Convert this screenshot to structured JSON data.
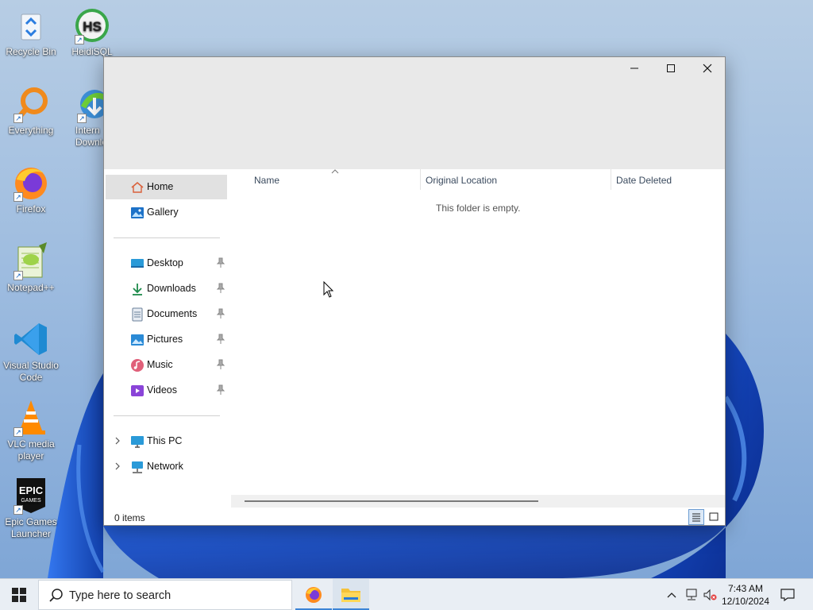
{
  "desktop": {
    "icons": [
      {
        "label": "Recycle Bin"
      },
      {
        "label": "HeidiSQL"
      },
      {
        "label": "Everything"
      },
      {
        "label": "Intern Downlo"
      },
      {
        "label": "Firefox"
      },
      {
        "label": "Notepad++"
      },
      {
        "label": "Visual Studio Code"
      },
      {
        "label": "VLC media player"
      },
      {
        "label": "Epic Games Launcher"
      }
    ]
  },
  "window": {
    "controls": {
      "minimize": "—",
      "maximize": "☐",
      "close": "✕"
    },
    "nav": {
      "items": [
        {
          "label": "Home",
          "icon": "home-icon",
          "selected": true
        },
        {
          "label": "Gallery",
          "icon": "gallery-icon"
        },
        {
          "label": "Desktop",
          "icon": "desktop-icon",
          "pinned": true
        },
        {
          "label": "Downloads",
          "icon": "downloads-icon",
          "pinned": true
        },
        {
          "label": "Documents",
          "icon": "documents-icon",
          "pinned": true
        },
        {
          "label": "Pictures",
          "icon": "pictures-icon",
          "pinned": true
        },
        {
          "label": "Music",
          "icon": "music-icon",
          "pinned": true
        },
        {
          "label": "Videos",
          "icon": "videos-icon",
          "pinned": true
        },
        {
          "label": "This PC",
          "icon": "this-pc-icon",
          "expandable": true
        },
        {
          "label": "Network",
          "icon": "network-icon",
          "expandable": true
        }
      ]
    },
    "columns": [
      "Name",
      "Original Location",
      "Date Deleted"
    ],
    "empty_message": "This folder is empty.",
    "status": {
      "item_count": "0 items"
    }
  },
  "taskbar": {
    "search_placeholder": "Type here to search",
    "apps": [
      "Firefox",
      "File Explorer"
    ],
    "clock": {
      "time": "7:43 AM",
      "date": "12/10/2024"
    }
  },
  "colors": {
    "accent": "#3b84d6",
    "selection": "#e1e1e1",
    "titlebar": "#e9e9e9"
  }
}
